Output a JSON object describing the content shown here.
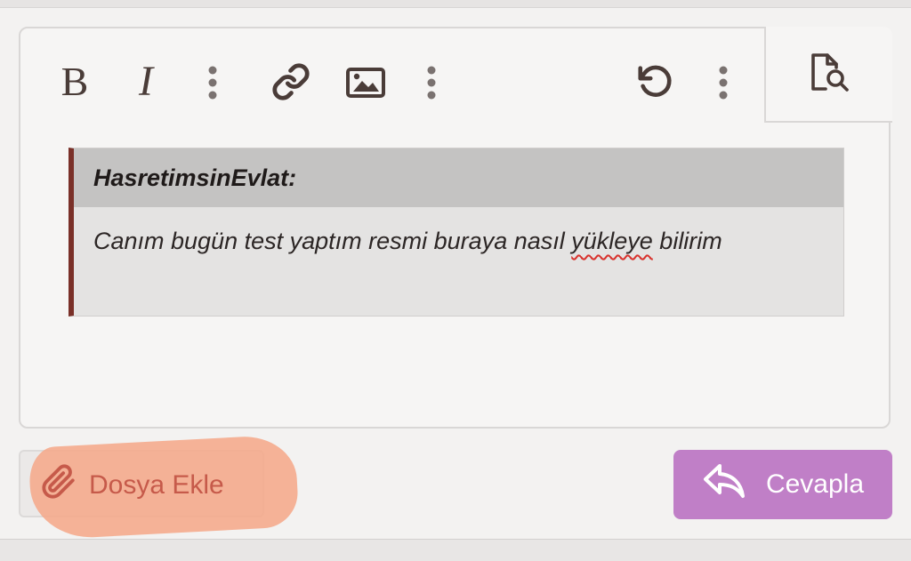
{
  "toolbar": {
    "bold_label": "B",
    "italic_label": "I",
    "icons": [
      "more-vertical-icon",
      "link-icon",
      "image-icon",
      "undo-icon",
      "preview-search-icon"
    ]
  },
  "quote": {
    "author": "HasretimsinEvlat:",
    "text_before": "Canım bugün test yaptım resmi buraya nasıl ",
    "misspelled": "yükleye",
    "text_after": " bilirim"
  },
  "buttons": {
    "attach_label": "Dosya Ekle",
    "reply_label": "Cevapla"
  },
  "colors": {
    "reply_button": "#c07fc7",
    "quote_border": "#7a3028",
    "attach_text": "#c65a4a",
    "highlight": "#f5a88a"
  }
}
